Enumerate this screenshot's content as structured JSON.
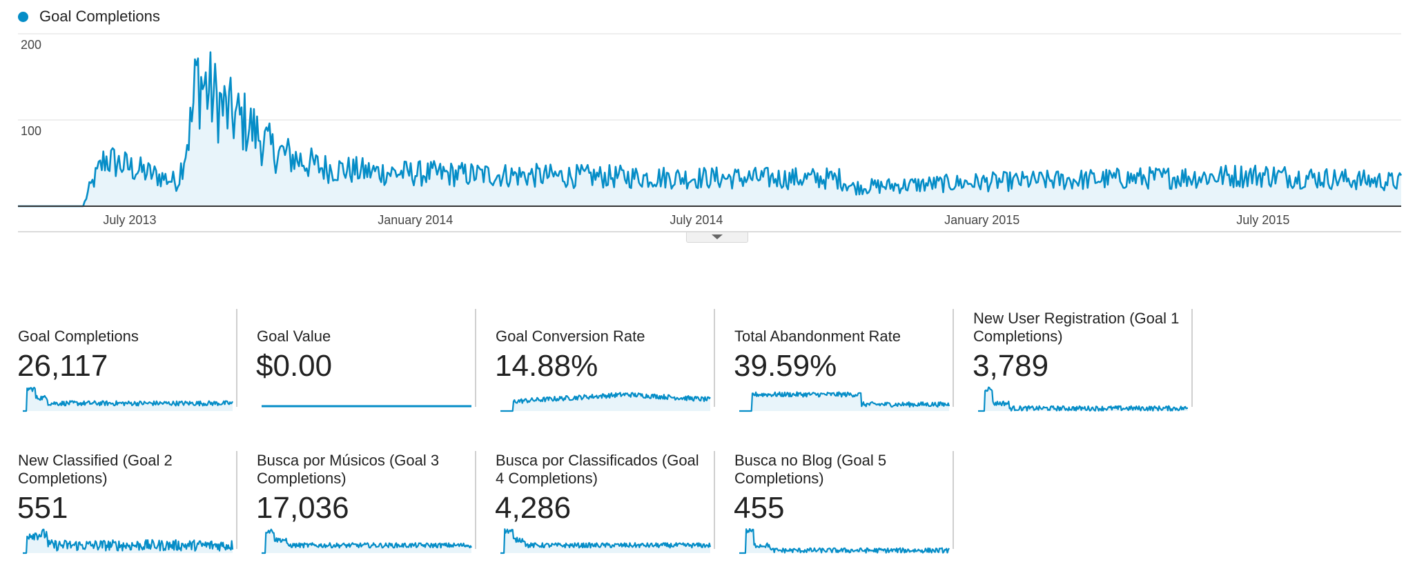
{
  "legend": {
    "label": "Goal Completions",
    "color": "#058dc7"
  },
  "chart_data": [
    {
      "type": "area",
      "series": [
        {
          "name": "Goal Completions",
          "color": "#058dc7",
          "fill": "#e8f4fa"
        }
      ],
      "x_range": [
        "2013-04-20",
        "2015-09-28"
      ],
      "ylim": [
        0,
        200
      ],
      "y_ticks": [
        "200",
        "100"
      ],
      "x_tick_labels": [
        {
          "date": "2013-07-01",
          "label": "July 2013"
        },
        {
          "date": "2014-01-01",
          "label": "January 2014"
        },
        {
          "date": "2014-07-01",
          "label": "July 2014"
        },
        {
          "date": "2015-01-01",
          "label": "January 2015"
        },
        {
          "date": "2015-07-01",
          "label": "July 2015"
        }
      ],
      "grid": true,
      "legend_position": "top-left",
      "daily_values_estimated": {
        "2013-05-01": 0,
        "2013-06-01": 0,
        "2013-06-05": 20,
        "2013-06-15": 55,
        "2013-07-01": 45,
        "2013-08-01": 28,
        "2013-08-10": 100,
        "2013-08-13": 150,
        "2013-09-01": 110,
        "2013-09-15": 95,
        "2013-10-01": 65,
        "2013-11-01": 45,
        "2013-12-01": 40,
        "2014-01-01": 38,
        "2014-04-01": 35,
        "2014-07-01": 33,
        "2014-10-01": 32,
        "2014-10-10": 22,
        "2015-01-01": 28,
        "2015-04-01": 32,
        "2015-07-01": 36,
        "2015-09-28": 28
      }
    },
    {
      "type": "line",
      "chart": "scorecard sparklines",
      "scorecards": [
        {
          "label": "Goal Completions",
          "value": "26,117",
          "profile": "decay"
        },
        {
          "label": "Goal Value",
          "value": "$0.00",
          "profile": "flat"
        },
        {
          "label": "Goal Conversion Rate",
          "value": "14.88%",
          "profile": "rate"
        },
        {
          "label": "Total Abandonment Rate",
          "value": "39.59%",
          "profile": "abandon"
        },
        {
          "label": "New User Registration (Goal 1 Completions)",
          "value": "3,789",
          "profile": "fade"
        },
        {
          "label": "New Classified (Goal 2 Completions)",
          "value": "551",
          "profile": "noisy"
        },
        {
          "label": "Busca por Músicos (Goal 3 Completions)",
          "value": "17,036",
          "profile": "decay"
        },
        {
          "label": "Busca por Classificados (Goal 4 Completions)",
          "value": "4,286",
          "profile": "decay"
        },
        {
          "label": "Busca no Blog (Goal 5 Completions)",
          "value": "455",
          "profile": "fade"
        }
      ]
    }
  ]
}
